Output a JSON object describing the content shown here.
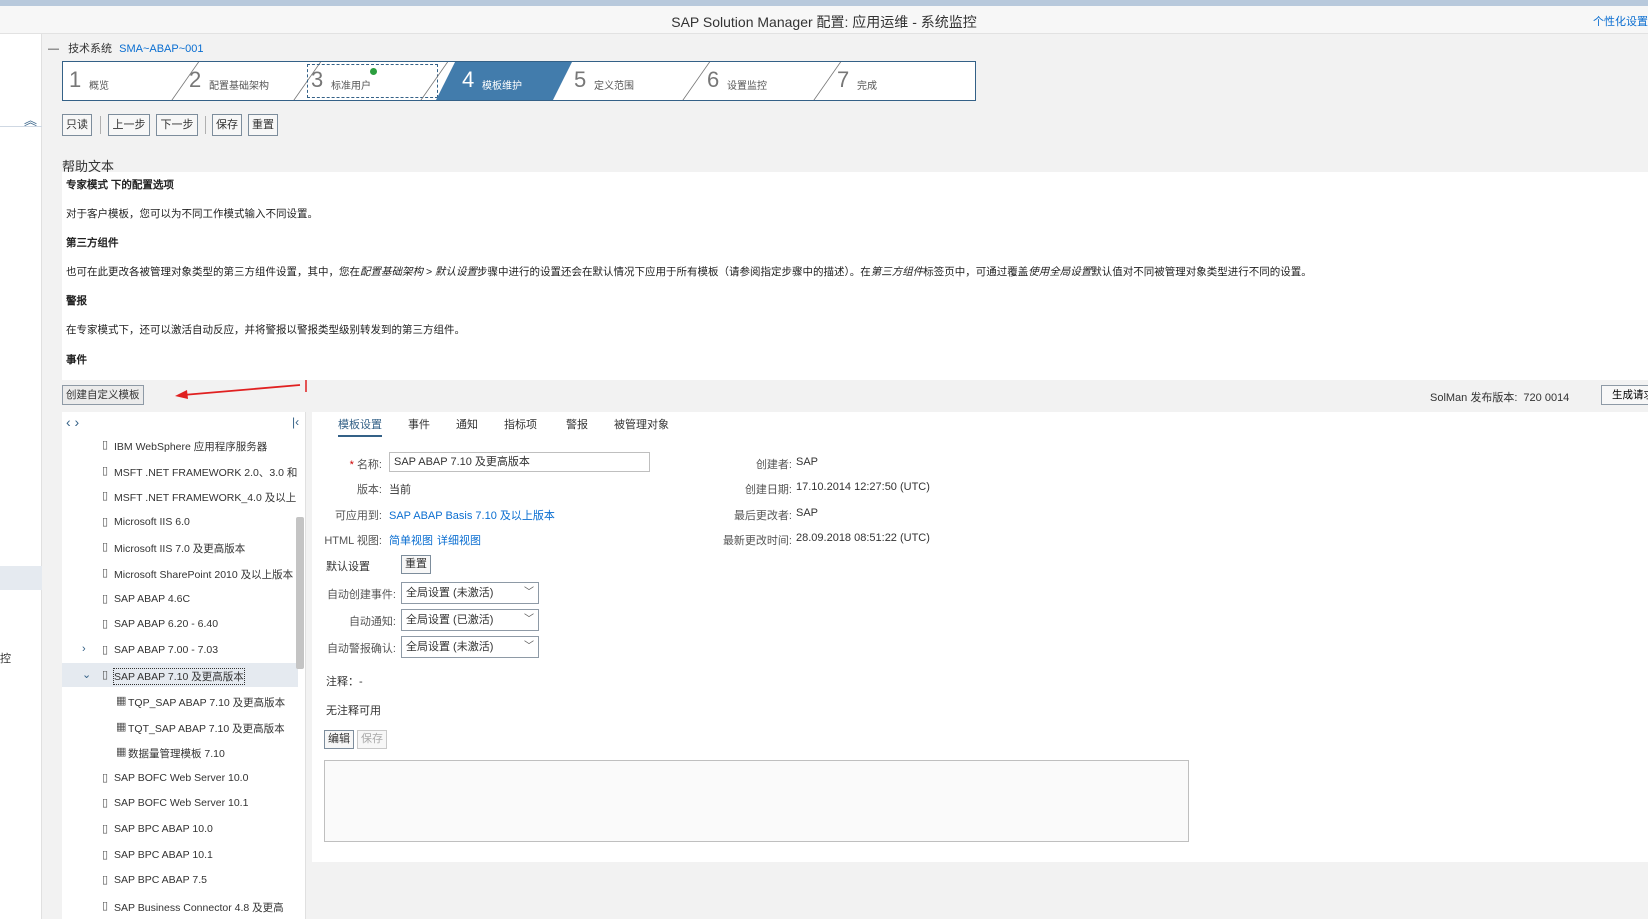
{
  "window": {
    "title": "SAP Solution Manager 配置: 应用运维 - 系统监控",
    "personalize": "个性化设置"
  },
  "left_rail": {
    "partial_text": "控"
  },
  "system": {
    "dash": "—",
    "label": "技术系统",
    "value": "SMA~ABAP~001"
  },
  "roadmap": {
    "steps": [
      {
        "num": "1",
        "label": "概览"
      },
      {
        "num": "2",
        "label": "配置基础架构"
      },
      {
        "num": "3",
        "label": "标准用户"
      },
      {
        "num": "4",
        "label": "模板维护"
      },
      {
        "num": "5",
        "label": "定义范围"
      },
      {
        "num": "6",
        "label": "设置监控"
      },
      {
        "num": "7",
        "label": "完成"
      }
    ]
  },
  "toolbar": {
    "readonly": "只读",
    "prev": "上一步",
    "next": "下一步",
    "save": "保存",
    "reset": "重置"
  },
  "help": {
    "label": "帮助文本",
    "h1": "专家模式 下的配置选项",
    "p1": "对于客户模板，您可以为不同工作模式输入不同设置。",
    "h2": "第三方组件",
    "p2a": "也可在此更改各被管理对象类型的第三方组件设置，其中，您在",
    "p2b": "配置基础架构 > 默认设置",
    "p2c": "步骤中进行的设置还会在默认情况下应用于所有模板（请参阅指定步骤中的描述）。在",
    "p2d": "第三方组件",
    "p2e": "标签页中，可通过覆盖",
    "p2f": "使用全局设置",
    "p2g": "默认值对不同被管理对象类型进行不同的设置。",
    "h3": "警报",
    "p3": "在专家模式下，还可以激活自动反应，并将警报以警报类型级别转发到的第三方组件。",
    "h4": "事件"
  },
  "actions": {
    "create_template": "创建自定义模板",
    "generate": "生成请求"
  },
  "solman": {
    "label": "SolMan 发布版本:",
    "value": "720 0014"
  },
  "tree": {
    "nav": "‹ ›",
    "collapse": "|‹",
    "items": [
      {
        "label": "IBM WebSphere 应用程序服务器",
        "expander": ""
      },
      {
        "label": "MSFT .NET FRAMEWORK 2.0、3.0 和",
        "expander": ""
      },
      {
        "label": "MSFT .NET FRAMEWORK_4.0 及以上",
        "expander": ""
      },
      {
        "label": "Microsoft IIS 6.0",
        "expander": ""
      },
      {
        "label": "Microsoft IIS 7.0 及更高版本",
        "expander": ""
      },
      {
        "label": "Microsoft SharePoint 2010 及以上版本",
        "expander": ""
      },
      {
        "label": "SAP ABAP 4.6C",
        "expander": ""
      },
      {
        "label": "SAP ABAP 6.20 - 6.40",
        "expander": ""
      },
      {
        "label": "SAP ABAP 7.00 - 7.03",
        "expander": "›"
      },
      {
        "label": "SAP ABAP 7.10 及更高版本",
        "expander": "⌄"
      },
      {
        "label": "TQP_SAP ABAP 7.10 及更高版本",
        "expander": ""
      },
      {
        "label": "TQT_SAP ABAP 7.10 及更高版本",
        "expander": ""
      },
      {
        "label": "数据量管理模板 7.10",
        "expander": ""
      },
      {
        "label": "SAP BOFC Web Server 10.0",
        "expander": ""
      },
      {
        "label": "SAP BOFC Web Server 10.1",
        "expander": ""
      },
      {
        "label": "SAP BPC ABAP 10.0",
        "expander": ""
      },
      {
        "label": "SAP BPC ABAP 10.1",
        "expander": ""
      },
      {
        "label": "SAP BPC ABAP 7.5",
        "expander": ""
      },
      {
        "label": "SAP Business Connector 4.8 及更高",
        "expander": ""
      }
    ]
  },
  "tabs": [
    "模板设置",
    "事件",
    "通知",
    "指标项",
    "警报",
    "被管理对象"
  ],
  "form": {
    "name_label": "名称:",
    "name_value": "SAP ABAP 7.10 及更高版本",
    "version_label": "版本:",
    "version_value": "当前",
    "applicable_label": "可应用到:",
    "applicable_value": "SAP ABAP Basis 7.10 及以上版本",
    "html_label": "HTML 视图:",
    "html_simple": "简单视图",
    "html_detail": "详细视图",
    "created_by_label": "创建者:",
    "created_by_value": "SAP",
    "created_on_label": "创建日期:",
    "created_on_value": "17.10.2014 12:27:50 (UTC)",
    "changed_by_label": "最后更改者:",
    "changed_by_value": "SAP",
    "changed_on_label": "最新更改时间:",
    "changed_on_value": "28.09.2018 08:51:22 (UTC)",
    "default_settings": "默认设置",
    "reset": "重置",
    "auto_event_label": "自动创建事件:",
    "auto_event_value": "全局设置 (未激活)",
    "auto_notify_label": "自动通知:",
    "auto_notify_value": "全局设置 (已激活)",
    "auto_confirm_label": "自动警报确认:",
    "auto_confirm_value": "全局设置 (未激活)",
    "notes_label": "注释：-",
    "no_notes": "无注释可用",
    "edit": "编辑",
    "save": "保存"
  },
  "colors": {
    "accent": "#346187",
    "active_step": "#427cac",
    "link": "#0a6ed1",
    "arrow": "#e02020"
  }
}
